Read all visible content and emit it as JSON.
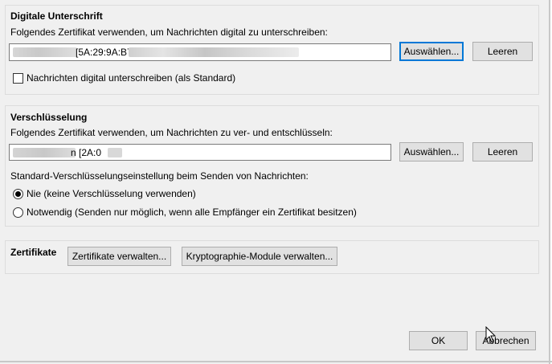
{
  "signing": {
    "title": "Digitale Unterschrift",
    "description": "Folgendes Zertifikat verwenden, um Nachrichten digital zu unterschreiben:",
    "certificate_value": "[5A:29:9A:B7:",
    "select_button": "Auswählen...",
    "clear_button": "Leeren",
    "sign_by_default_label": "Nachrichten digital unterschreiben (als Standard)",
    "sign_by_default_checked": false
  },
  "encryption": {
    "title": "Verschlüsselung",
    "description": "Folgendes Zertifikat verwenden, um Nachrichten zu ver- und entschlüsseln:",
    "certificate_value": "n [2A:0",
    "select_button": "Auswählen...",
    "clear_button": "Leeren",
    "default_setting_label": "Standard-Verschlüsselungseinstellung beim Senden von Nachrichten:",
    "options": [
      {
        "label": "Nie (keine Verschlüsselung verwenden)",
        "selected": true
      },
      {
        "label": "Notwendig (Senden nur möglich, wenn alle Empfänger ein Zertifikat besitzen)",
        "selected": false
      }
    ]
  },
  "certificates": {
    "title": "Zertifikate",
    "manage_button": "Zertifikate verwalten...",
    "modules_button": "Kryptographie-Module verwalten..."
  },
  "dialog": {
    "ok_button": "OK",
    "cancel_button": "Abbrechen"
  },
  "icons": {
    "cursor": "mouse-pointer-icon",
    "radio_selected": "radio-selected-icon",
    "radio_empty": "radio-empty-icon",
    "checkbox": "checkbox-unchecked-icon"
  }
}
